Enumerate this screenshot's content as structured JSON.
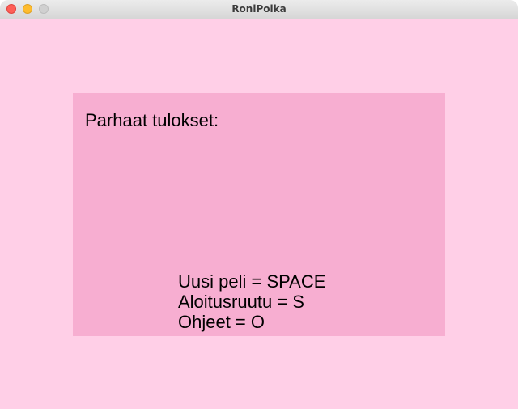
{
  "window": {
    "title": "RoniPoika",
    "controls": {
      "close_color": "#fe5f57",
      "minimize_color": "#febc2e",
      "zoom_color": "#d0d0d0"
    }
  },
  "colors": {
    "background": "#ffcfe7",
    "panel": "#f7aed1"
  },
  "panel": {
    "heading": "Parhaat tulokset:",
    "scores": [],
    "instructions": [
      "Uusi peli = SPACE",
      "Aloitusruutu = S",
      "Ohjeet = O"
    ]
  }
}
